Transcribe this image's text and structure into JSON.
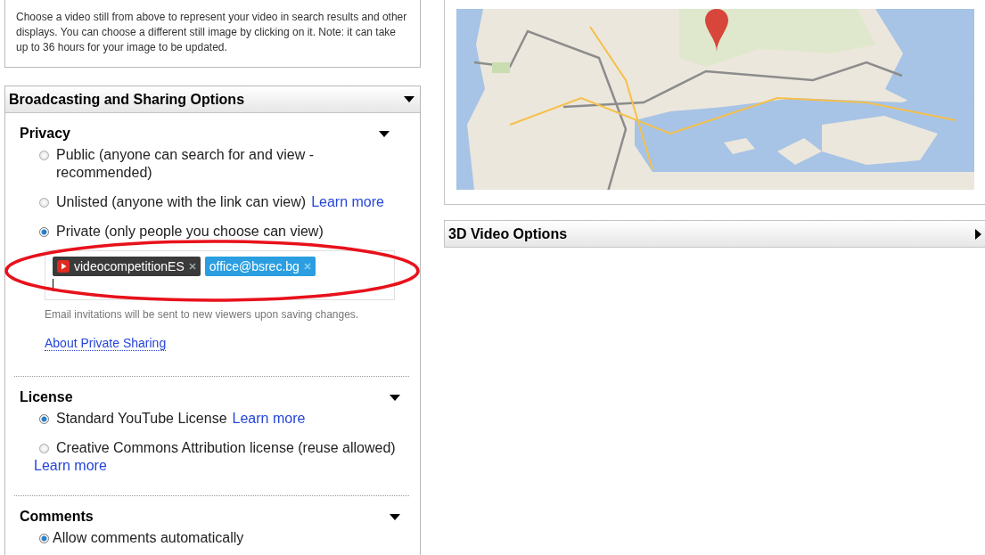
{
  "still_note": "Choose a video still from above to represent your video in search results and other displays. You can choose a different still image by clicking on it. Note: it can take up to 36 hours for your image to be updated.",
  "broadcasting": {
    "title": "Broadcasting and Sharing Options",
    "expanded": true,
    "sections": [
      {
        "kind": "privacy",
        "title": "Privacy",
        "expanded": true,
        "options": [
          {
            "label": "Public (anyone can search for and view - recommended)",
            "selected": false
          },
          {
            "label": "Unlisted (anyone with the link can view)",
            "link": "Learn more",
            "selected": false
          },
          {
            "label": "Private (only people you choose can view)",
            "selected": true
          }
        ],
        "share_field": {
          "tags": [
            {
              "label": "videocompetitionES",
              "kind": "channel"
            },
            {
              "label": "office@bsrec.bg",
              "kind": "email"
            }
          ]
        },
        "hint": "Email invitations will be sent to new viewers upon saving changes.",
        "about_link": "About Private Sharing"
      },
      {
        "kind": "license",
        "title": "License",
        "expanded": true,
        "options": [
          {
            "label": "Standard YouTube License",
            "link": "Learn more",
            "selected": true
          },
          {
            "label": "Creative Commons Attribution license (reuse allowed)",
            "link": "Learn more",
            "selected": false
          }
        ]
      },
      {
        "kind": "comments",
        "title": "Comments",
        "expanded": true,
        "options": [
          {
            "label": "Allow comments automatically",
            "selected": true
          }
        ]
      }
    ]
  },
  "video_3d": {
    "title": "3D Video Options",
    "expanded": false
  }
}
